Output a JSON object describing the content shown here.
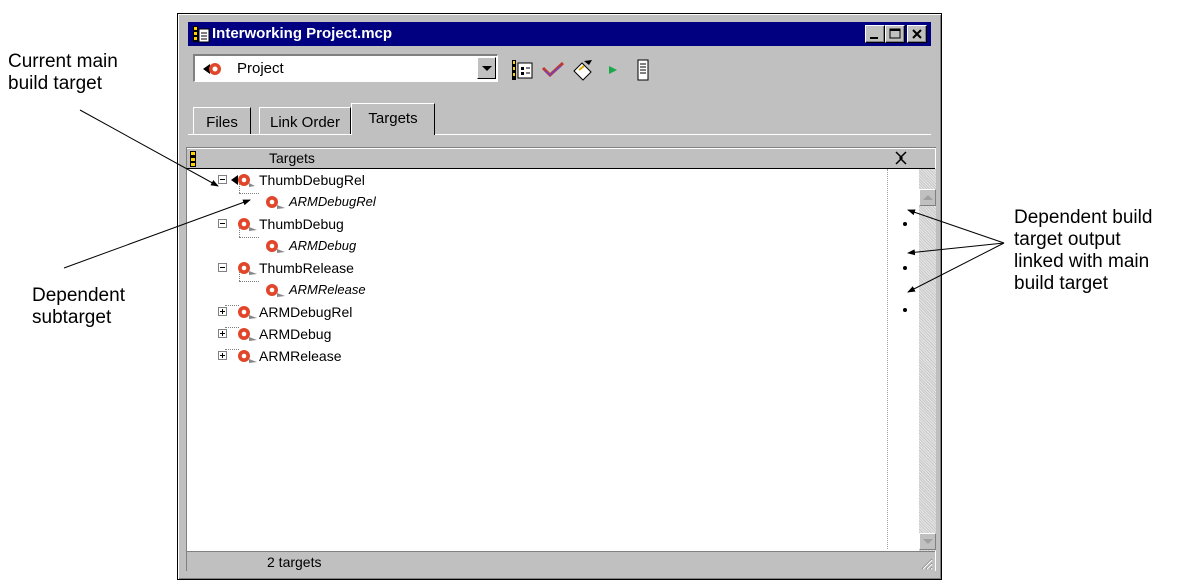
{
  "window": {
    "title": "Interworking Project.mcp",
    "controls": [
      "minimize",
      "maximize",
      "close"
    ]
  },
  "toolbar": {
    "target_dropdown_value": "Project",
    "buttons": [
      "target-settings-icon",
      "check-syntax-icon",
      "make-icon",
      "run-icon",
      "debug-icon"
    ]
  },
  "tabs": [
    {
      "label": "Files",
      "active": false
    },
    {
      "label": "Link Order",
      "active": false
    },
    {
      "label": "Targets",
      "active": true
    }
  ],
  "column_header": {
    "title": "Targets"
  },
  "tree": [
    {
      "label": "ThumbDebugRel",
      "level": 0,
      "expanded": true,
      "current": true,
      "linked": false
    },
    {
      "label": "ARMDebugRel",
      "level": 1,
      "italic": true,
      "linked": true
    },
    {
      "label": "ThumbDebug",
      "level": 0,
      "expanded": true,
      "current": false,
      "linked": false
    },
    {
      "label": "ARMDebug",
      "level": 1,
      "italic": true,
      "linked": true
    },
    {
      "label": "ThumbRelease",
      "level": 0,
      "expanded": true,
      "current": false,
      "linked": false
    },
    {
      "label": "ARMRelease",
      "level": 1,
      "italic": true,
      "linked": true
    },
    {
      "label": "ARMDebugRel",
      "level": 0,
      "expanded": false,
      "current": false,
      "linked": false
    },
    {
      "label": "ARMDebug",
      "level": 0,
      "expanded": false,
      "current": false,
      "linked": false
    },
    {
      "label": "ARMRelease",
      "level": 0,
      "expanded": false,
      "current": false,
      "linked": false
    }
  ],
  "status": {
    "text": "2 targets"
  },
  "annotations": {
    "current_main": "Current main\nbuild target",
    "dependent_subtarget": "Dependent\nsubtarget",
    "dependent_output": "Dependent build\ntarget output\nlinked with main\nbuild target"
  },
  "colors": {
    "titlebar": "#000080",
    "window": "#c0c0c0",
    "target_icon": "#e0472a"
  }
}
